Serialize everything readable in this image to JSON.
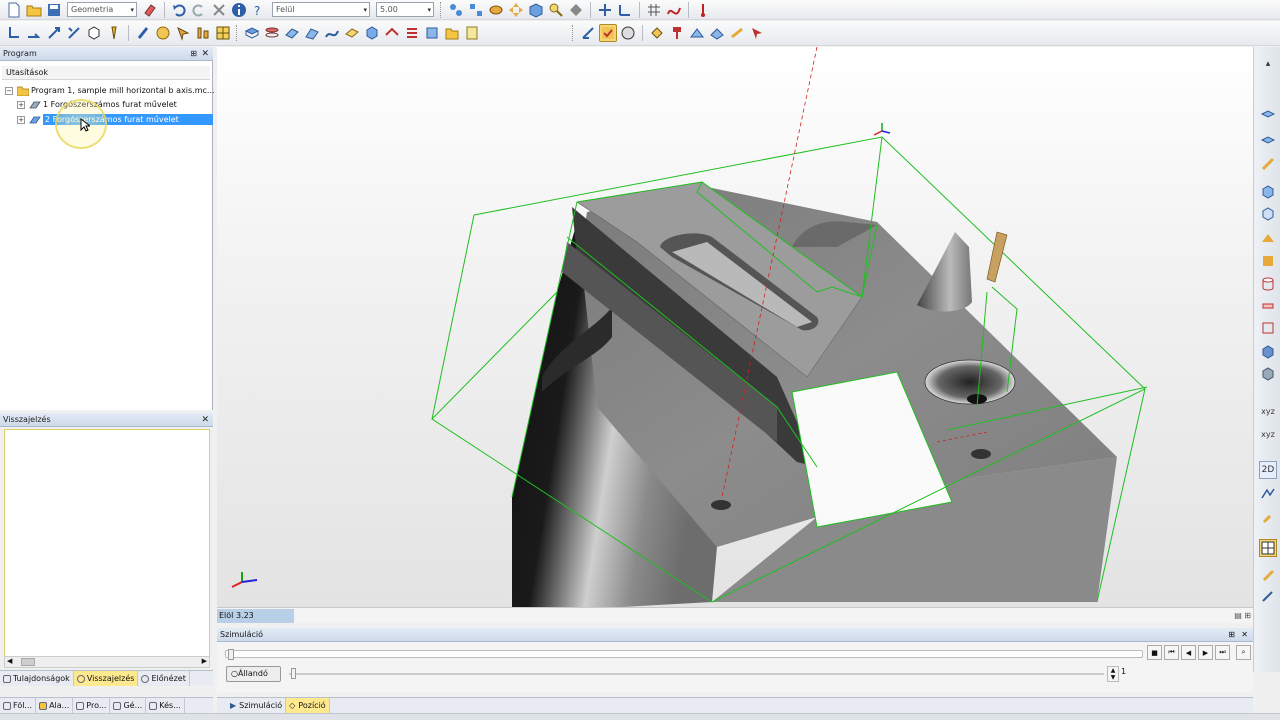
{
  "toolbar1": {
    "geometry_combo": "Geometria",
    "view_combo": "Felül",
    "value_combo": "5.00"
  },
  "program_panel": {
    "title": "Program",
    "header": "Utasítások",
    "program_item": "Program 1, sample mill horizontal b axis.mc...",
    "operations": [
      "1 Forgószerszámos furat művelet",
      "2 Forgószerszámos furat művelet"
    ]
  },
  "feedback_panel": {
    "title": "Visszajelzés"
  },
  "left_tabs": [
    "Tulajdonságok",
    "Visszajelzés",
    "Előnézet"
  ],
  "viewport": {
    "status_label": "Elöl 3.23"
  },
  "simulation": {
    "title": "Szimuláció",
    "mode_button": "Állandó",
    "counter": "1"
  },
  "bottom_tabs": {
    "left": [
      "Föl...",
      "Ala...",
      "Pro...",
      "Gé...",
      "Kés..."
    ],
    "right": [
      "Szimuláció",
      "Pozíció"
    ]
  },
  "colors": {
    "selection": "#3399ff",
    "wireframe": "#1fbf1f",
    "toolpath_red": "#d02020"
  }
}
